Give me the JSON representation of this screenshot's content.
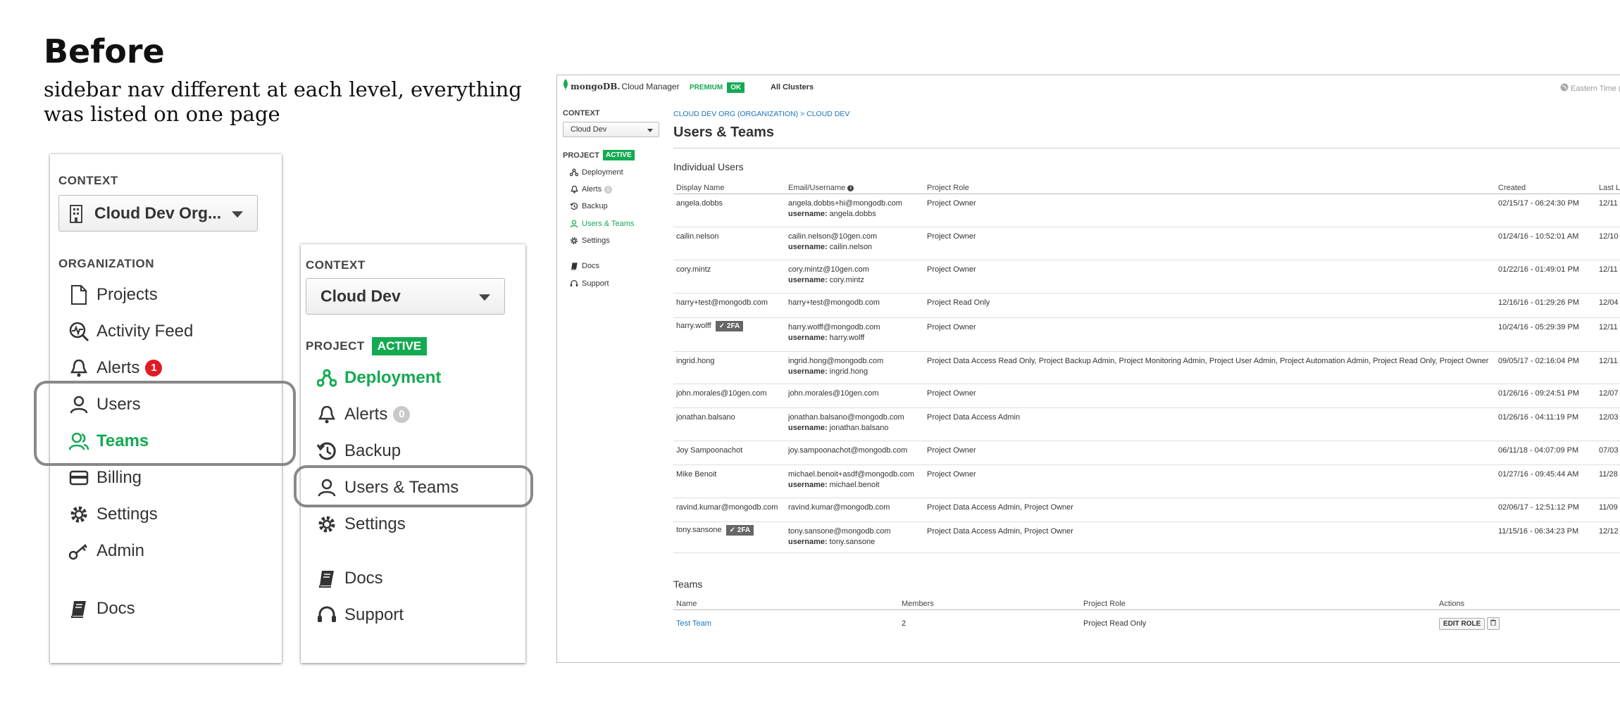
{
  "heading": "Before",
  "subtitle": "sidebar nav different at each level, everything was listed on one page",
  "org_panel": {
    "context_label": "CONTEXT",
    "context_value": "Cloud Dev Org...",
    "section_label": "ORGANIZATION",
    "items": [
      {
        "label": "Projects",
        "icon": "file-icon"
      },
      {
        "label": "Activity Feed",
        "icon": "activity-icon"
      },
      {
        "label": "Alerts",
        "icon": "bell-icon",
        "badge": "1"
      },
      {
        "label": "Users",
        "icon": "user-icon"
      },
      {
        "label": "Teams",
        "icon": "team-icon",
        "active": true
      },
      {
        "label": "Billing",
        "icon": "credit-card-icon"
      },
      {
        "label": "Settings",
        "icon": "gear-icon"
      },
      {
        "label": "Admin",
        "icon": "key-icon"
      },
      {
        "label": "Docs",
        "icon": "book-icon"
      }
    ]
  },
  "project_panel": {
    "context_label": "CONTEXT",
    "context_value": "Cloud Dev",
    "section_label": "PROJECT",
    "status": "ACTIVE",
    "items": [
      {
        "label": "Deployment",
        "icon": "deployment-icon",
        "active": true
      },
      {
        "label": "Alerts",
        "icon": "bell-icon",
        "badge": "0"
      },
      {
        "label": "Backup",
        "icon": "backup-icon"
      },
      {
        "label": "Users & Teams",
        "icon": "user-icon"
      },
      {
        "label": "Settings",
        "icon": "gear-icon"
      },
      {
        "label": "Docs",
        "icon": "book-icon"
      },
      {
        "label": "Support",
        "icon": "support-icon"
      }
    ]
  },
  "app": {
    "logo_text": "mongoDB.",
    "product": "Cloud Manager",
    "plan": "PREMIUM",
    "plan_status": "OK",
    "clusters_link": "All Clusters",
    "timezone": "Eastern Time (",
    "sidebar": {
      "context_label": "CONTEXT",
      "context_value": "Cloud Dev",
      "project_label": "PROJECT",
      "project_status": "ACTIVE",
      "items": [
        {
          "label": "Deployment",
          "icon": "deployment-icon"
        },
        {
          "label": "Alerts",
          "icon": "bell-icon",
          "badge": "0"
        },
        {
          "label": "Backup",
          "icon": "backup-icon"
        },
        {
          "label": "Users & Teams",
          "icon": "user-icon",
          "active": true
        },
        {
          "label": "Settings",
          "icon": "gear-icon"
        },
        {
          "label": "Docs",
          "icon": "book-icon"
        },
        {
          "label": "Support",
          "icon": "support-icon"
        }
      ]
    },
    "breadcrumb": "CLOUD DEV ORG (ORGANIZATION) > CLOUD DEV",
    "page_title": "Users & Teams",
    "users_section": "Individual Users",
    "user_columns": [
      "Display Name",
      "Email/Username",
      "Project Role",
      "Created",
      "Last L"
    ],
    "username_prefix": "username:",
    "users": [
      {
        "name": "angela.dobbs",
        "email": "angela.dobbs+hi@mongodb.com",
        "username": "angela.dobbs",
        "role": "Project Owner",
        "created": "02/15/17 - 06:24:30 PM",
        "last": "12/11"
      },
      {
        "name": "cailin.nelson",
        "email": "cailin.nelson@10gen.com",
        "username": "cailin.nelson",
        "role": "Project Owner",
        "created": "01/24/16 - 10:52:01 AM",
        "last": "12/10"
      },
      {
        "name": "cory.mintz",
        "email": "cory.mintz@10gen.com",
        "username": "cory.mintz",
        "role": "Project Owner",
        "created": "01/22/16 - 01:49:01 PM",
        "last": "12/11"
      },
      {
        "name": "harry+test@mongodb.com",
        "email": "harry+test@mongodb.com",
        "username": "",
        "role": "Project Read Only",
        "created": "12/16/16 - 01:29:26 PM",
        "last": "12/04"
      },
      {
        "name": "harry.wolff",
        "tfa": "✓ 2FA",
        "email": "harry.wolff@mongodb.com",
        "username": "harry.wolff",
        "role": "Project Owner",
        "created": "10/24/16 - 05:29:39 PM",
        "last": "12/11"
      },
      {
        "name": "ingrid.hong",
        "email": "ingrid.hong@mongodb.com",
        "username": "ingrid.hong",
        "role": "Project Data Access Read Only, Project Backup Admin, Project Monitoring Admin, Project User Admin, Project Automation Admin, Project Read Only, Project Owner",
        "created": "09/05/17 - 02:16:04 PM",
        "last": "12/11"
      },
      {
        "name": "john.morales@10gen.com",
        "email": "john.morales@10gen.com",
        "username": "",
        "role": "Project Owner",
        "created": "01/26/16 - 09:24:51 PM",
        "last": "12/07"
      },
      {
        "name": "jonathan.balsano",
        "email": "jonathan.balsano@mongodb.com",
        "username": "jonathan.balsano",
        "role": "Project Data Access Admin",
        "created": "01/26/16 - 04:11:19 PM",
        "last": "12/03"
      },
      {
        "name": "Joy Sampoonachot",
        "email": "joy.sampoonachot@mongodb.com",
        "username": "",
        "role": "Project Owner",
        "created": "06/11/18 - 04:07:09 PM",
        "last": "07/03"
      },
      {
        "name": "Mike Benoit",
        "email": "michael.benoit+asdf@mongodb.com",
        "username": "michael.benoit",
        "role": "Project Owner",
        "created": "01/27/16 - 09:45:44 AM",
        "last": "11/28"
      },
      {
        "name": "ravind.kumar@mongodb.com",
        "email": "ravind.kumar@mongodb.com",
        "username": "",
        "role": "Project Data Access Admin, Project Owner",
        "created": "02/06/17 - 12:51:12 PM",
        "last": "11/09"
      },
      {
        "name": "tony.sansone",
        "tfa": "✓ 2FA",
        "email": "tony.sansone@mongodb.com",
        "username": "tony.sansone",
        "role": "Project Data Access Admin, Project Owner",
        "created": "11/15/16 - 06:34:23 PM",
        "last": "12/12"
      }
    ],
    "teams_section": "Teams",
    "team_columns": [
      "Name",
      "Members",
      "Project Role",
      "Actions"
    ],
    "teams": [
      {
        "name": "Test Team",
        "members": "2",
        "role": "Project Read Only",
        "action": "EDIT ROLE"
      }
    ],
    "colors": {
      "brand_green": "#13aa52",
      "link_blue": "#1a75bb",
      "alert_red": "#e01b24"
    }
  }
}
